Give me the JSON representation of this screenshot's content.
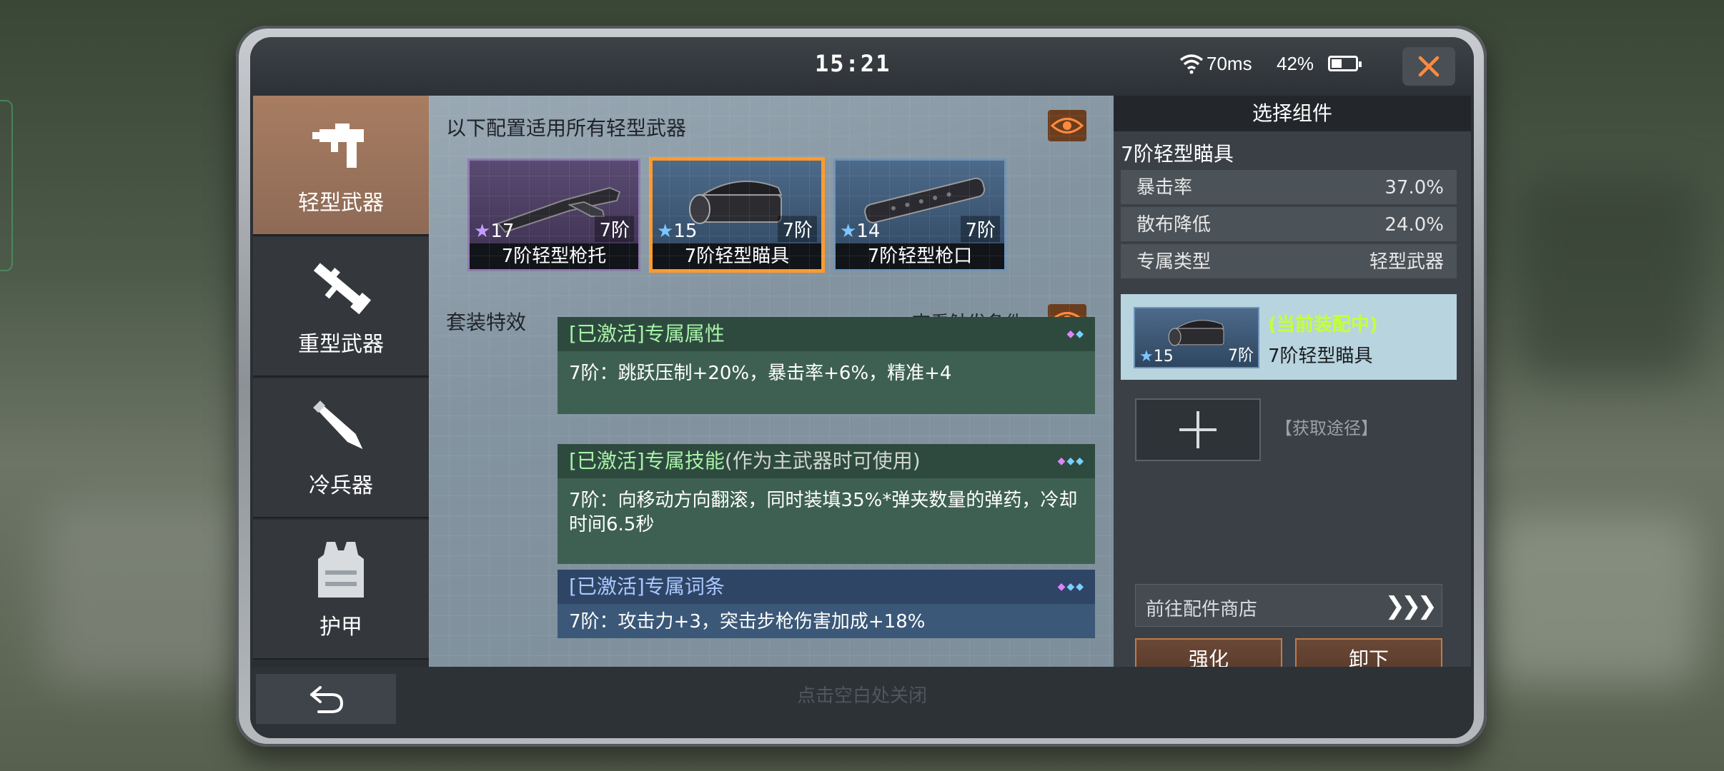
{
  "status_bar": {
    "time": "15:21",
    "ping": "70ms",
    "battery": "42%"
  },
  "nav": {
    "items": [
      {
        "label": "轻型武器",
        "icon": "smg-icon",
        "active": true
      },
      {
        "label": "重型武器",
        "icon": "rocket-launcher-icon",
        "active": false
      },
      {
        "label": "冷兵器",
        "icon": "knife-icon",
        "active": false
      },
      {
        "label": "护甲",
        "icon": "vest-icon",
        "active": false
      }
    ]
  },
  "config": {
    "heading": "以下配置适用所有轻型武器",
    "components": [
      {
        "name": "7阶轻型枪托",
        "stars": "17",
        "tier": "7阶",
        "rarity": "purple",
        "selected": false
      },
      {
        "name": "7阶轻型瞄具",
        "stars": "15",
        "tier": "7阶",
        "rarity": "blue",
        "selected": true
      },
      {
        "name": "7阶轻型枪口",
        "stars": "14",
        "tier": "7阶",
        "rarity": "blue",
        "selected": false
      }
    ]
  },
  "set_effects": {
    "heading": "套装特效",
    "trigger_link": "查看触发条件",
    "items": [
      {
        "title": "[已激活]专属属性",
        "subtitle": "",
        "text": "7阶：跳跃压制+20%，暴击率+6%，精准+4"
      },
      {
        "title": "[已激活]专属技能",
        "subtitle": "(作为主武器时可使用)",
        "text": "7阶：向移动方向翻滚，同时装填35%*弹夹数量的弹药，冷却时间6.5秒"
      },
      {
        "title": "[已激活]专属词条",
        "subtitle": "",
        "text": "7阶：攻击力+3，突击步枪伤害加成+18%"
      }
    ]
  },
  "panel": {
    "header": "选择组件",
    "component_title": "7阶轻型瞄具",
    "stats": [
      {
        "key": "暴击率",
        "value": "37.0%"
      },
      {
        "key": "散布降低",
        "value": "24.0%"
      },
      {
        "key": "专属类型",
        "value": "轻型武器"
      }
    ],
    "equipped": {
      "badge": "(当前装配中)",
      "name": "7阶轻型瞄具",
      "stars": "15",
      "tier": "7阶"
    },
    "acquire_link": "【获取途径】",
    "shop_link": "前往配件商店",
    "enhance_button": "强化",
    "unequip_button": "卸下"
  },
  "bottom": {
    "hint": "点击空白处关闭"
  },
  "colors": {
    "accent_orange": "#ff9a2e",
    "active_tab": "#a87d62",
    "equipped_badge": "#c6ff3a"
  }
}
